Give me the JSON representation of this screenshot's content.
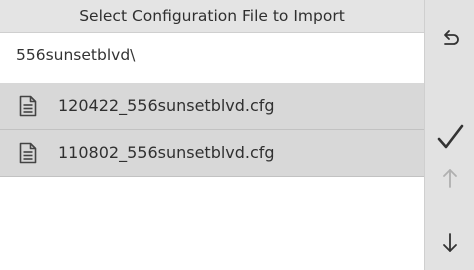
{
  "dialog": {
    "title": "Select Configuration File to Import",
    "current_path": "556sunsetblvd\\"
  },
  "files": [
    {
      "name": "120422_556sunsetblvd.cfg",
      "icon": "document-icon"
    },
    {
      "name": "110802_556sunsetblvd.cfg",
      "icon": "document-icon"
    }
  ],
  "sidebar": {
    "buttons": [
      {
        "icon": "back-arrow-icon",
        "enabled": true
      },
      {
        "icon": "checkmark-icon",
        "enabled": true
      },
      {
        "icon": "arrow-up-icon",
        "enabled": false
      },
      {
        "icon": "arrow-down-icon",
        "enabled": true
      }
    ]
  },
  "colors": {
    "title_bar_bg": "#e4e4e4",
    "list_item_bg": "#d8d8d8",
    "sidebar_bg": "#e2e2e2",
    "icon_active": "#333333",
    "icon_disabled": "#b0b0b0"
  }
}
